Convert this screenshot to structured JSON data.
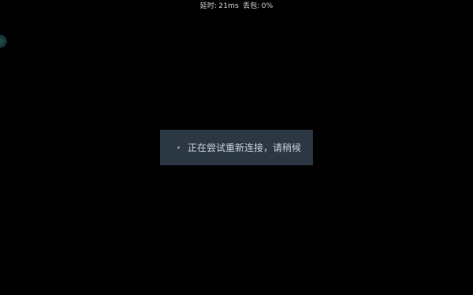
{
  "stats": {
    "latency_label": "延时:",
    "latency_value": "21ms",
    "loss_label": "丢包:",
    "loss_value": "0%"
  },
  "toast": {
    "message": "正在尝试重新连接，请稍候"
  },
  "colors": {
    "background": "#000000",
    "toast_bg": "#2c3744",
    "float_ball": "#1f4f4c"
  }
}
